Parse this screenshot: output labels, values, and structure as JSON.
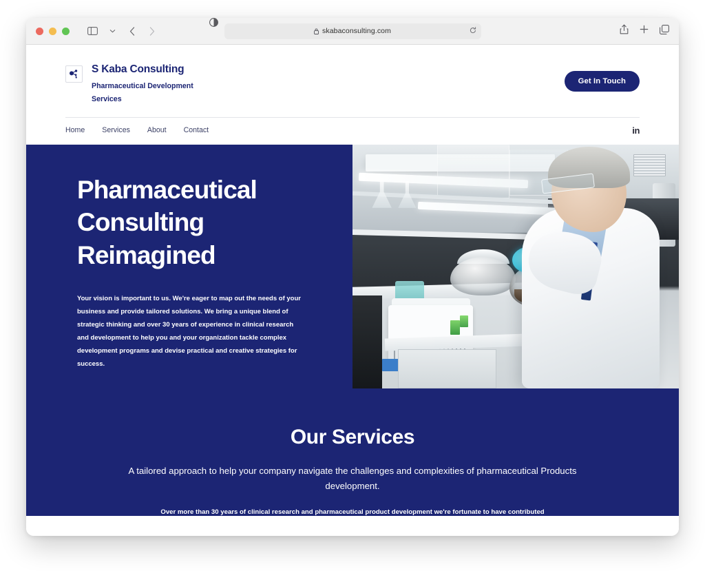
{
  "browser": {
    "url": "skabaconsulting.com",
    "lock_icon": "lock-icon",
    "reload_icon": "reload-icon",
    "sidebar_icon": "sidebar-toggle-icon",
    "chevron_icon": "chevron-down-icon",
    "back_icon": "back-arrow-icon",
    "forward_icon": "forward-arrow-icon",
    "reader_icon": "reader-mode-icon",
    "share_icon": "share-icon",
    "new_tab_icon": "plus-icon",
    "tabs_icon": "tabs-overview-icon"
  },
  "site": {
    "brand": {
      "name": "S Kaba Consulting",
      "tagline": "Pharmaceutical Development Services",
      "logo_icon": "molecule-icon"
    },
    "cta_label": "Get In Touch",
    "nav": [
      {
        "label": "Home"
      },
      {
        "label": "Services"
      },
      {
        "label": "About"
      },
      {
        "label": "Contact"
      }
    ],
    "social": {
      "linkedin_label": "in",
      "linkedin_icon": "linkedin-icon"
    },
    "hero": {
      "title": "Pharmaceutical Consulting Reimagined",
      "paragraph": "Your vision is important to us. We're eager to map out the needs of your business and provide tailored solutions. We bring a unique blend of strategic thinking and over 30 years of experience in clinical research and development to help you and your organization tackle complex development programs and devise practical and creative strategies for success.",
      "image_alt": "Scientist in white lab coat and safety glasses holding a flask with blue liquid in a laboratory"
    },
    "services": {
      "title": "Our Services",
      "subtitle": "A tailored approach to help your company navigate the challenges and complexities of pharmaceutical Products development.",
      "note": "Over more than 30 years of clinical research and pharmaceutical product development we're fortunate to have contributed"
    }
  },
  "colors": {
    "brand_navy": "#1c2574",
    "page_white": "#ffffff",
    "toolbar_gray": "#f2f2f2"
  }
}
